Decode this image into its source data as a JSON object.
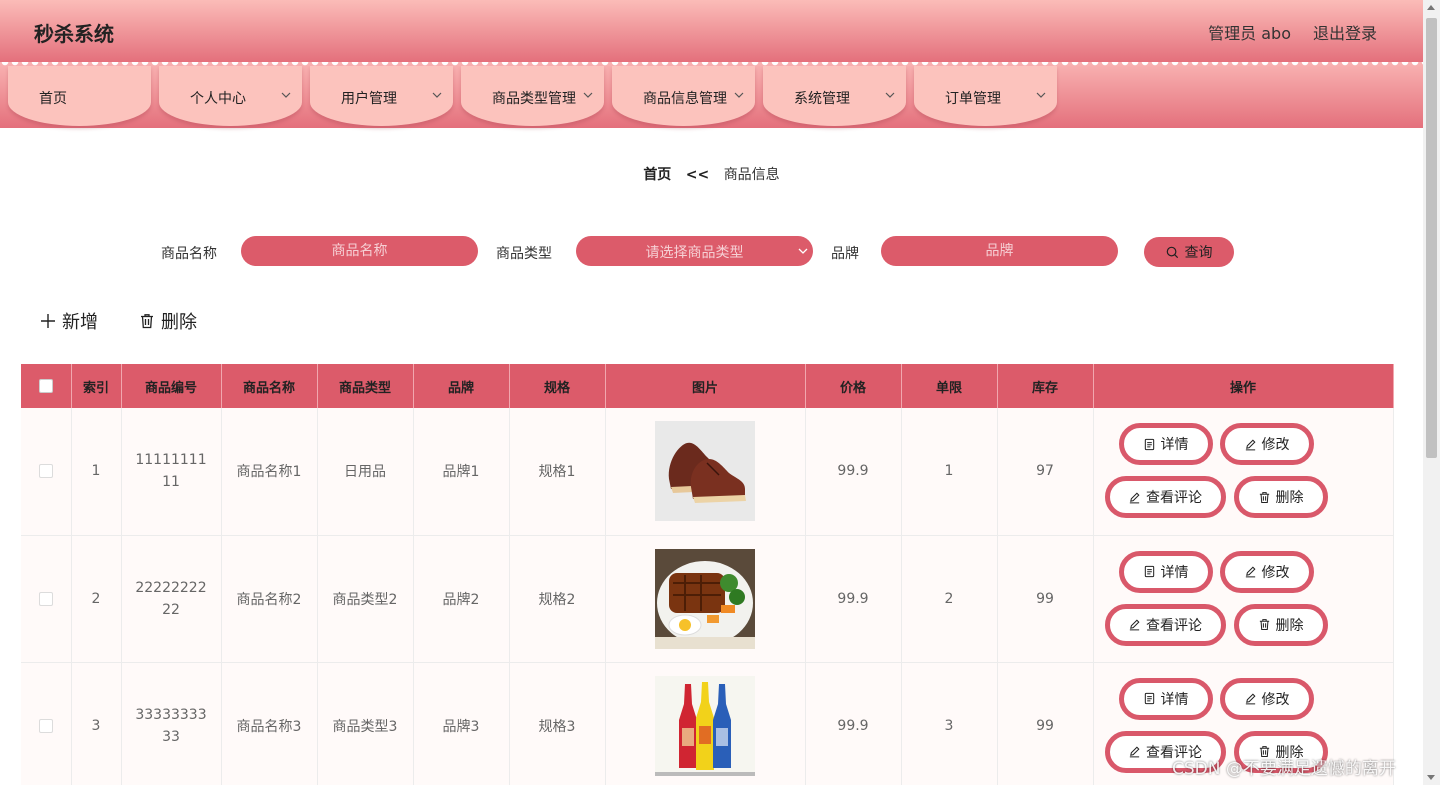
{
  "header": {
    "title": "秒杀系统",
    "user": "管理员 abo",
    "logout": "退出登录"
  },
  "nav": [
    {
      "label": "首页",
      "has_menu": false
    },
    {
      "label": "个人中心",
      "has_menu": true
    },
    {
      "label": "用户管理",
      "has_menu": true
    },
    {
      "label": "商品类型管理",
      "has_menu": true
    },
    {
      "label": "商品信息管理",
      "has_menu": true
    },
    {
      "label": "系统管理",
      "has_menu": true
    },
    {
      "label": "订单管理",
      "has_menu": true
    }
  ],
  "breadcrumb": {
    "home": "首页",
    "separator": "<<",
    "current": "商品信息"
  },
  "search": {
    "name_label": "商品名称",
    "name_placeholder": "商品名称",
    "type_label": "商品类型",
    "type_placeholder": "请选择商品类型",
    "brand_label": "品牌",
    "brand_placeholder": "品牌",
    "query_label": "查询"
  },
  "toolbar": {
    "add_label": "新增",
    "delete_label": "删除"
  },
  "table": {
    "headers": [
      "",
      "索引",
      "商品编号",
      "商品名称",
      "商品类型",
      "品牌",
      "规格",
      "图片",
      "价格",
      "单限",
      "库存",
      "操作"
    ],
    "rows": [
      {
        "index": "1",
        "code": "1111111111",
        "name": "商品名称1",
        "type": "日用品",
        "brand": "品牌1",
        "spec": "规格1",
        "image": "shoe",
        "price": "99.9",
        "limit": "1",
        "stock": "97"
      },
      {
        "index": "2",
        "code": "2222222222",
        "name": "商品名称2",
        "type": "商品类型2",
        "brand": "品牌2",
        "spec": "规格2",
        "image": "food",
        "price": "99.9",
        "limit": "2",
        "stock": "99"
      },
      {
        "index": "3",
        "code": "3333333333",
        "name": "商品名称3",
        "type": "商品类型3",
        "brand": "品牌3",
        "spec": "规格3",
        "image": "bottles",
        "price": "99.9",
        "limit": "3",
        "stock": "99"
      }
    ],
    "actions": {
      "detail": "详情",
      "edit": "修改",
      "comments": "查看评论",
      "delete": "删除"
    }
  },
  "watermark": "CSDN @不要满足遗憾的离开",
  "colors": {
    "accent": "#dc5b6a",
    "header_top": "#fbbcb8",
    "header_bottom": "#e4707c",
    "nav_tab": "#fcc3bd"
  }
}
